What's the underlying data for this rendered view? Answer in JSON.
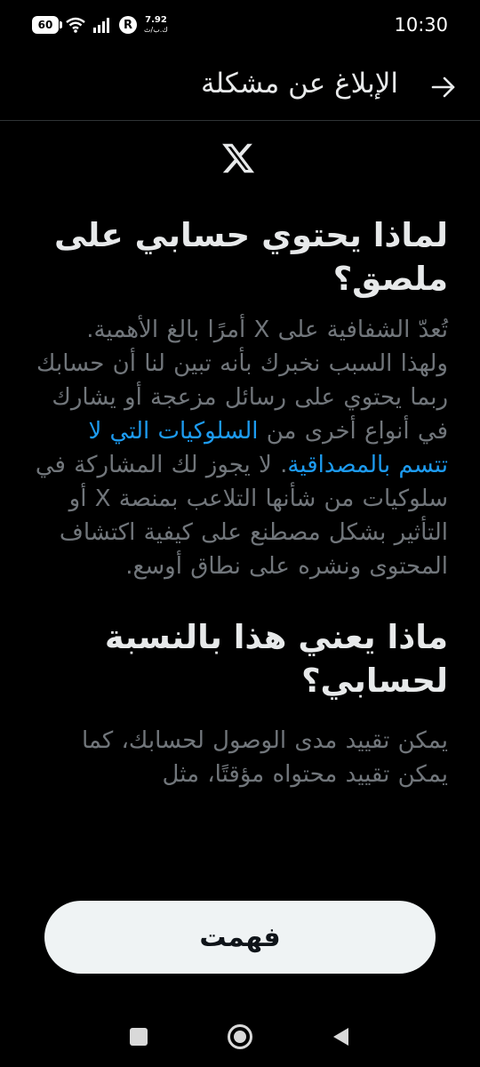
{
  "status_bar": {
    "battery": "60",
    "speed_value": "7.92",
    "speed_unit": "ك.ب/ث",
    "r_badge": "R",
    "time": "10:30"
  },
  "header": {
    "title": "الإبلاغ عن مشكلة"
  },
  "content": {
    "heading_1": "لماذا يحتوي حسابي على ملصق؟",
    "paragraph_1_before_link": "تُعدّ الشفافية على X أمرًا بالغ الأهمية. ولهذا السبب نخبرك بأنه تبين لنا أن حسابك ربما يحتوي على رسائل مزعجة أو يشارك في أنواع أخرى من ",
    "paragraph_1_link": "السلوكيات التي لا تتسم بالمصداقية",
    "paragraph_1_after_link": ". لا يجوز لك المشاركة في سلوكيات من شأنها التلاعب بمنصة X أو التأثير بشكل مصطنع على كيفية اكتشاف المحتوى ونشره على نطاق أوسع.",
    "heading_2": "ماذا يعني هذا بالنسبة لحسابي؟",
    "paragraph_2": "يمكن تقييد مدى الوصول لحسابك، كما يمكن تقييد محتواه مؤقتًا، مثل"
  },
  "footer": {
    "button_label": "فهمت"
  },
  "colors": {
    "background": "#000000",
    "text_primary": "#e7e9ea",
    "text_secondary": "#71767b",
    "link": "#1d9bf0",
    "button_bg": "#eff3f4"
  },
  "icons": {
    "back": "arrow-right-icon",
    "logo": "x-logo-icon"
  }
}
